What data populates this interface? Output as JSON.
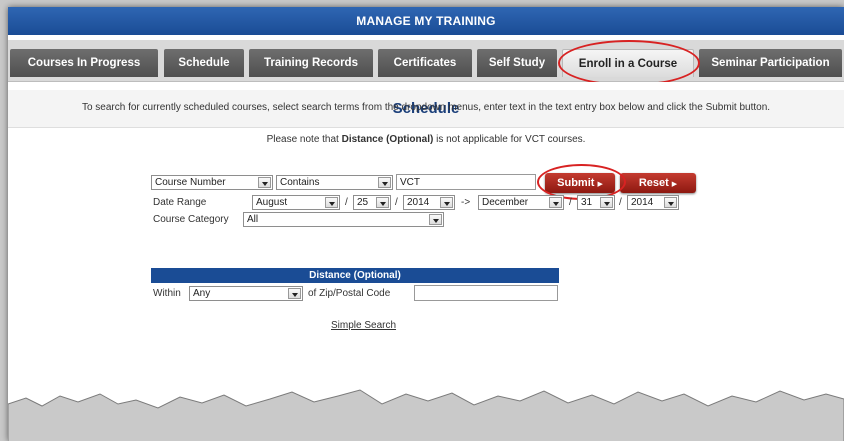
{
  "header": {
    "title": "MANAGE MY TRAINING"
  },
  "tabs": [
    {
      "label": "Courses In Progress"
    },
    {
      "label": "Schedule"
    },
    {
      "label": "Training Records"
    },
    {
      "label": "Certificates"
    },
    {
      "label": "Self Study"
    },
    {
      "label": "Enroll in a Course",
      "active": true
    },
    {
      "label": "Seminar Participation"
    }
  ],
  "page": {
    "title": "Schedule",
    "instructions": "To search for currently scheduled courses, select search terms from the dropdown menus, enter text in the text entry box below and click the Submit button.",
    "note_prefix": "Please note that ",
    "note_bold": "Distance (Optional)",
    "note_suffix": " is not applicable for VCT courses."
  },
  "search": {
    "field": "Course Number",
    "operator": "Contains",
    "text": "VCT",
    "submit_label": "Submit",
    "reset_label": "Reset"
  },
  "date_range": {
    "label": "Date Range",
    "from_month": "August",
    "from_day": "25",
    "from_year": "2014",
    "slash": "/",
    "arrow": "->",
    "to_month": "December",
    "to_day": "31",
    "to_year": "2014"
  },
  "category": {
    "label": "Course Category",
    "value": "All"
  },
  "distance": {
    "heading": "Distance (Optional)",
    "within_label": "Within",
    "within_value": "Any",
    "zip_label": "of Zip/Postal Code",
    "zip_value": ""
  },
  "links": {
    "simple_search": "Simple Search"
  },
  "colors": {
    "header_blue": "#1a4c95",
    "button_red": "#a8241a",
    "highlight_circle": "#d82222"
  }
}
